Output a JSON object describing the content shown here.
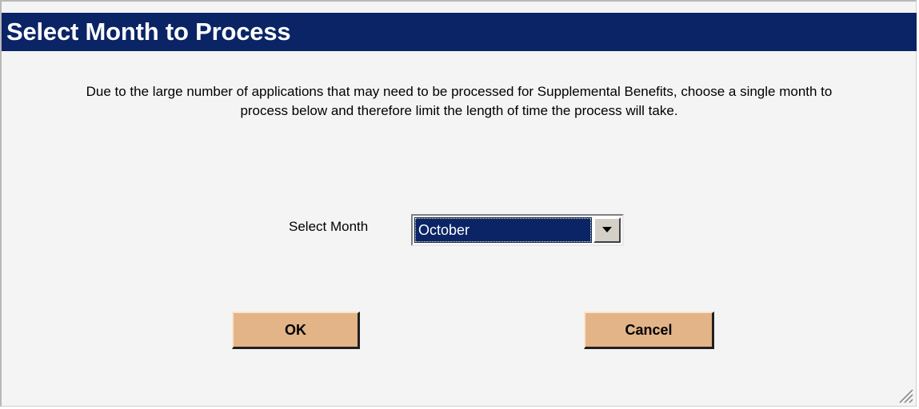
{
  "dialog": {
    "title": "Select Month to Process",
    "message": "Due to the large number of applications that may need to be processed for Supplemental Benefits, choose a single month to process below and therefore limit the length of time the process will take.",
    "month_label": "Select Month",
    "month_selected": "October",
    "ok_label": "OK",
    "cancel_label": "Cancel"
  },
  "icons": {
    "dropdown": "chevron-down-icon",
    "resize": "resize-grip-icon"
  },
  "colors": {
    "title_bar": "#0a2466",
    "title_text": "#ffffff",
    "background": "#f4f4f4",
    "button": "#e2b488",
    "selected_option": "#0a2466"
  }
}
